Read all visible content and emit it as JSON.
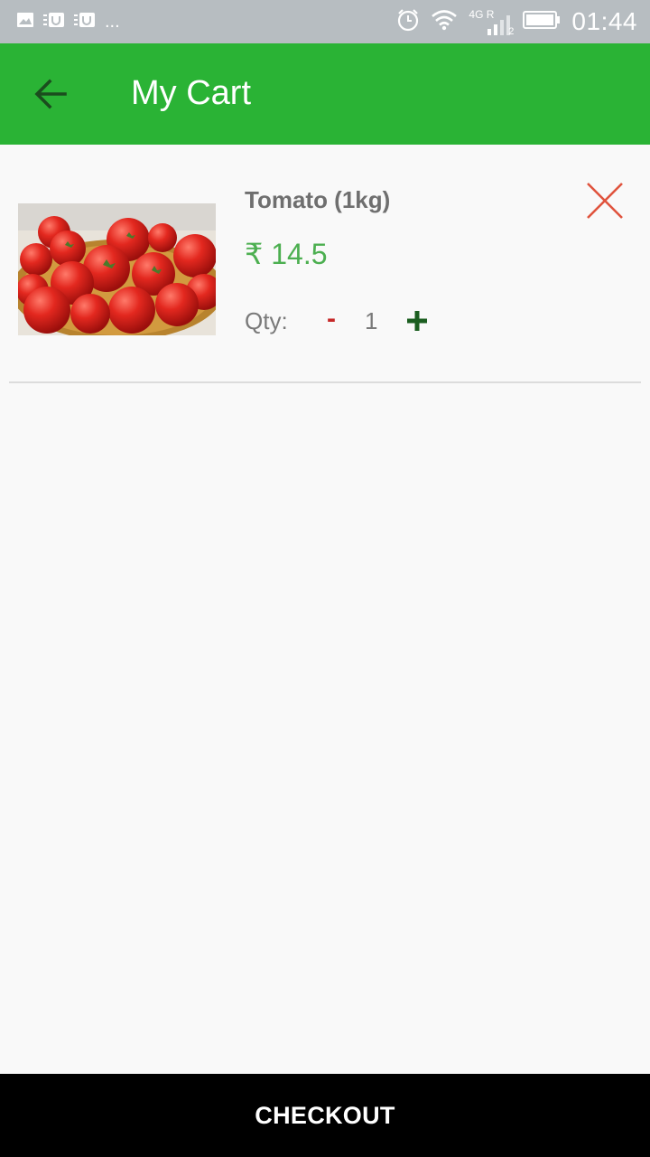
{
  "status_bar": {
    "time": "01:44",
    "network_label": "4G R",
    "sim_slot": "2",
    "overflow_dots": "...",
    "icons": [
      "image-icon",
      "notification-icon",
      "notification-icon",
      "alarm-icon",
      "wifi-icon",
      "signal-icon",
      "battery-icon"
    ]
  },
  "app_bar": {
    "title": "My Cart",
    "back_icon": "arrow-back-icon",
    "background_color": "#2ab335"
  },
  "cart": {
    "items": [
      {
        "name": "Tomato (1kg)",
        "price": "₹ 14.5",
        "qty_label": "Qty:",
        "qty_minus": "-",
        "quantity": "1",
        "remove_icon": "close-icon",
        "image_icon": "tomato-photo"
      }
    ]
  },
  "checkout": {
    "label": "CHECKOUT",
    "background_color": "#000000"
  },
  "colors": {
    "price": "#4caf50",
    "minus": "#c62828",
    "plus": "#1b5e20",
    "remove": "#e53935"
  }
}
